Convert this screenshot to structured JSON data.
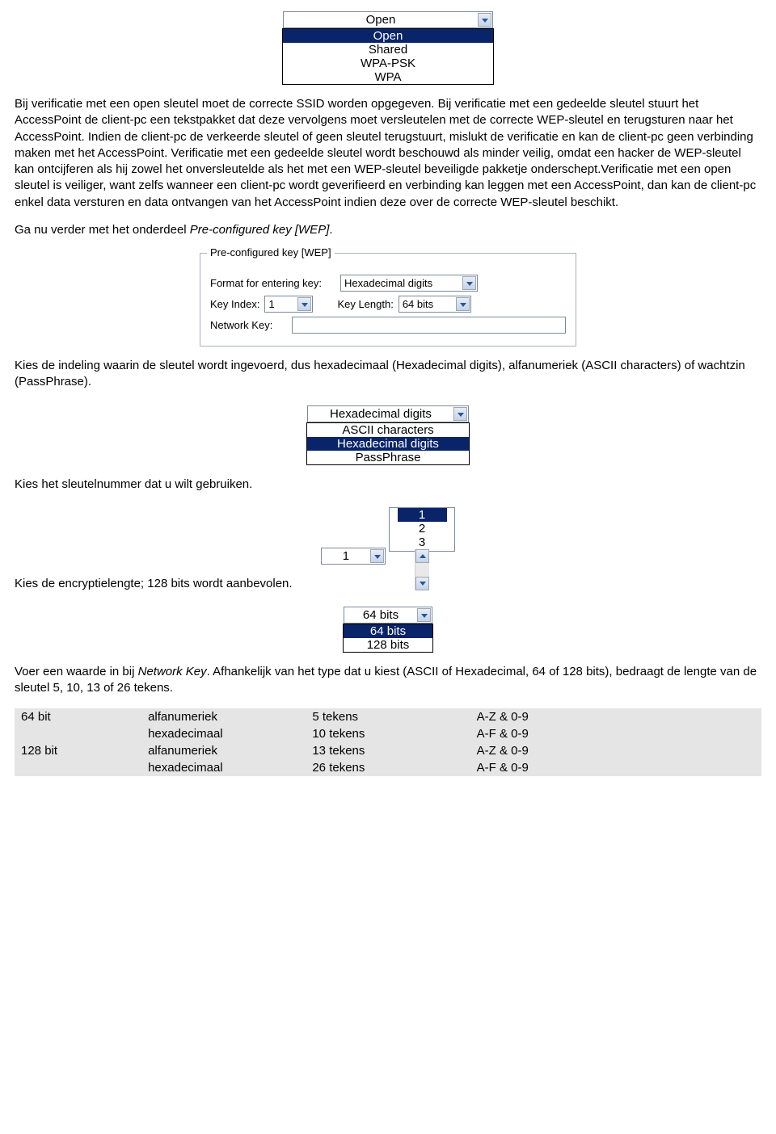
{
  "auth_dropdown": {
    "selected": "Open",
    "options": [
      "Open",
      "Shared",
      "WPA-PSK",
      "WPA"
    ]
  },
  "para1_a": "Bij verificatie met een open sleutel moet de correcte SSID worden opgegeven. Bij verificatie met een gedeelde sleutel stuurt het AccessPoint de client-pc een tekstpakket dat deze vervolgens moet versleutelen met de correcte WEP-sleutel en terugsturen naar het AccessPoint. Indien de client-pc de verkeerde sleutel of geen sleutel terugstuurt, mislukt de verificatie en kan de client-pc geen verbinding maken met het AccessPoint. Verificatie met een gedeelde sleutel wordt beschouwd als minder veilig, omdat een hacker de WEP-sleutel kan ontcijferen als hij zowel het onversleutelde als het met een WEP-sleutel beveiligde pakketje onderschept.Verificatie met een open sleutel is veiliger, want zelfs wanneer een client-pc wordt geverifieerd en verbinding kan leggen met een AccessPoint, dan kan de client-pc enkel data versturen en data ontvangen van het AccessPoint indien deze over de correcte WEP-sleutel beschikt.",
  "para2_pre": "Ga nu verder met het onderdeel ",
  "para2_it": "Pre-configured key [WEP]",
  "para2_post": ".",
  "fieldset": {
    "legend": "Pre-configured key [WEP]",
    "format_label": "Format for entering key:",
    "format_value": "Hexadecimal digits",
    "keyindex_label": "Key Index:",
    "keyindex_value": "1",
    "keylength_label": "Key Length:",
    "keylength_value": "64 bits",
    "networkkey_label": "Network Key:"
  },
  "para3": "Kies de indeling waarin de sleutel wordt ingevoerd, dus hexadecimaal (Hexadecimal digits), alfanumeriek (ASCII characters) of wachtzin (PassPhrase).",
  "format_dd": {
    "selected": "Hexadecimal digits",
    "options": [
      "ASCII characters",
      "Hexadecimal digits",
      "PassPhrase"
    ]
  },
  "para4": "Kies het sleutelnummer dat u wilt gebruiken.",
  "keyindex_dd": {
    "selected": "1",
    "options": [
      "1",
      "2",
      "3"
    ]
  },
  "para5": "Kies de encryptielengte; 128 bits wordt aanbevolen.",
  "keylength_dd": {
    "selected": "64 bits",
    "options": [
      "64 bits",
      "128 bits"
    ]
  },
  "para6_pre": "Voer een waarde in bij ",
  "para6_it": "Network Key",
  "para6_post": ". Afhankelijk van het type dat u kiest (ASCII of Hexadecimal, 64 of 128 bits), bedraagt de lengte van de sleutel 5, 10, 13 of 26 tekens.",
  "table": {
    "rows": [
      [
        "64 bit",
        "alfanumeriek",
        "5 tekens",
        "A-Z & 0-9"
      ],
      [
        "",
        "hexadecimaal",
        "10 tekens",
        "A-F & 0-9"
      ],
      [
        "128 bit",
        "alfanumeriek",
        "13 tekens",
        "A-Z & 0-9"
      ],
      [
        "",
        "hexadecimaal",
        "26 tekens",
        "A-F & 0-9"
      ]
    ]
  }
}
